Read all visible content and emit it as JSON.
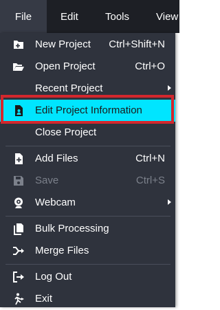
{
  "menubar": {
    "file": "File",
    "edit": "Edit",
    "tools": "Tools",
    "view": "View"
  },
  "menu": {
    "new_project": {
      "label": "New Project",
      "shortcut": "Ctrl+Shift+N",
      "icon": "new-project-icon"
    },
    "open_project": {
      "label": "Open Project",
      "shortcut": "Ctrl+O",
      "icon": "folder-open-icon"
    },
    "recent_project": {
      "label": "Recent Project"
    },
    "edit_project_information": {
      "label": "Edit Project Information",
      "icon": "document-user-icon"
    },
    "close_project": {
      "label": "Close Project"
    },
    "add_files": {
      "label": "Add Files",
      "shortcut": "Ctrl+N",
      "icon": "file-add-icon"
    },
    "save": {
      "label": "Save",
      "shortcut": "Ctrl+S",
      "icon": "save-icon",
      "disabled": true
    },
    "webcam": {
      "label": "Webcam",
      "icon": "webcam-icon"
    },
    "bulk_processing": {
      "label": "Bulk Processing",
      "icon": "bulk-processing-icon"
    },
    "merge_files": {
      "label": "Merge Files",
      "icon": "merge-icon"
    },
    "log_out": {
      "label": "Log Out",
      "icon": "log-out-icon"
    },
    "exit": {
      "label": "Exit",
      "icon": "exit-icon"
    }
  },
  "colors": {
    "menubar_bg": "#1d1f25",
    "menu_bg": "#2f333d",
    "highlight_bg": "#00e5ff",
    "highlight_border": "#d3272d",
    "disabled_text": "#7c818b"
  }
}
